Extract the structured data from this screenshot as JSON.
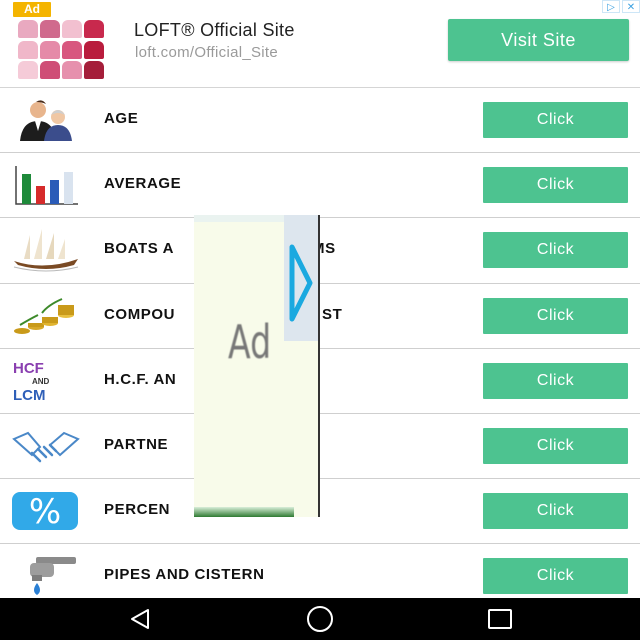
{
  "ad": {
    "tag": "Ad",
    "title": "LOFT® Official Site",
    "url": "loft.com/Official_Site",
    "button": "Visit Site",
    "adchoices_icons": [
      "adchoices-icon",
      "close-icon"
    ]
  },
  "list": {
    "items": [
      {
        "label": "AGE",
        "button": "Click",
        "icon": "people-icon"
      },
      {
        "label": "AVERAGE",
        "button": "Click",
        "icon": "bar-chart-icon"
      },
      {
        "label": "BOATS A",
        "label_tail": "MS",
        "button": "Click",
        "icon": "boat-icon"
      },
      {
        "label": "COMPOU",
        "label_tail": "ST",
        "button": "Click",
        "icon": "coins-icon"
      },
      {
        "label": "H.C.F. AN",
        "button": "Click",
        "icon": "hcf-lcm-icon"
      },
      {
        "label": "PARTNE",
        "button": "Click",
        "icon": "handshake-icon"
      },
      {
        "label": "PERCEN",
        "button": "Click",
        "icon": "percent-icon"
      },
      {
        "label": "PIPES AND CISTERN",
        "button": "Click",
        "icon": "tap-icon"
      }
    ]
  },
  "icon_text": {
    "hcf": "HCF",
    "and": "AND",
    "lcm": "LCM",
    "percent": "%"
  },
  "overlay_ad": {
    "text": "Ad",
    "icon": "play-icon"
  },
  "navbar": {
    "icons": [
      "back-icon",
      "home-icon",
      "recents-icon"
    ]
  },
  "colors": {
    "accent": "#4dc390",
    "ad_tag": "#f4b400",
    "navbar": "#000000"
  }
}
